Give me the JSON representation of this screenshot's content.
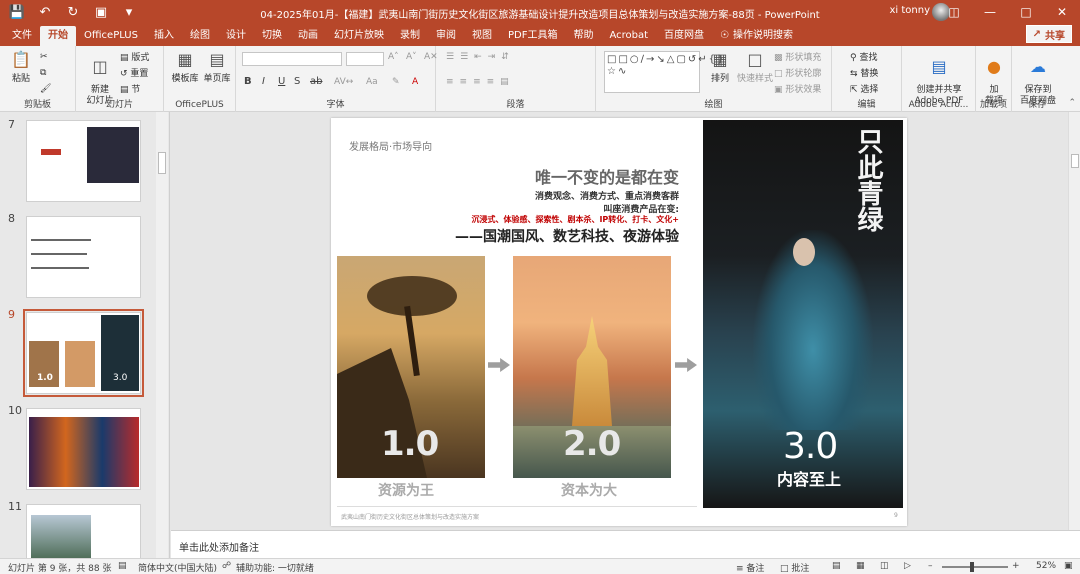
{
  "titlebar": {
    "doc_title": "04-2025年01月-【福建】武夷山南门街历史文化街区旅游基础设计提升改造项目总体策划与改造实施方案-88页 - PowerPoint",
    "user": "xi tonny",
    "icons": [
      "save-icon",
      "undo-icon",
      "redo-icon",
      "present-icon",
      "customize-icon"
    ]
  },
  "menu_tabs": [
    "文件",
    "开始",
    "OfficePLUS",
    "插入",
    "绘图",
    "设计",
    "切换",
    "动画",
    "幻灯片放映",
    "录制",
    "审阅",
    "视图",
    "PDF工具箱",
    "帮助",
    "Acrobat",
    "百度网盘"
  ],
  "active_tab": "开始",
  "tell_me": "操作说明搜索",
  "share": "共享",
  "ribbon": {
    "clipboard": {
      "paste": "粘贴",
      "group": "剪贴板"
    },
    "slides": {
      "new_slide": "新建\n幻灯片",
      "layout": "版式",
      "reset": "重置",
      "section": "节",
      "group": "幻灯片"
    },
    "officeplus": {
      "template": "模板库",
      "single_page": "单页库",
      "group": "OfficePLUS"
    },
    "font": {
      "bold": "B",
      "italic": "I",
      "underline": "U",
      "strike": "S",
      "shadow": "ab",
      "group": "字体"
    },
    "paragraph": {
      "group": "段落"
    },
    "drawing": {
      "arrange": "排列",
      "quick_styles": "快速样式",
      "shape_fill": "形状填充",
      "shape_outline": "形状轮廓",
      "shape_effects": "形状效果",
      "group": "绘图"
    },
    "editing": {
      "find": "查找",
      "replace": "替换",
      "select": "选择",
      "group": "编辑"
    },
    "adobe": {
      "create": "创建并共享\nAdobe PDF",
      "group": "Adobe Acro..."
    },
    "addins": {
      "addins": "加\n载项",
      "group": "加载项"
    },
    "save": {
      "save_baidu": "保存到\n百度网盘",
      "group": "保存"
    }
  },
  "thumbnails": [
    {
      "number": "7"
    },
    {
      "number": "8"
    },
    {
      "number": "9",
      "active": true,
      "num1": "1.0",
      "num3": "3.0"
    },
    {
      "number": "10"
    },
    {
      "number": "11"
    }
  ],
  "slide": {
    "kicker": "发展格局·市场导向",
    "headline": "唯一不变的是都在变",
    "subline1": "消费观念、消费方式、重点消费客群",
    "subline2": "叫座消费产品在变:",
    "red_line": "沉浸式、体验感、探索性、剧本杀、IP转化、打卡、文化+",
    "big_line": "——国潮国风、数艺科技、夜游体验",
    "stage1_number": "1.0",
    "stage1_caption": "资源为王",
    "stage2_number": "2.0",
    "stage2_caption": "资本为大",
    "stage3_number": "3.0",
    "stage3_caption": "内容至上",
    "calligraphy": "只此青绿",
    "footer": "武夷山南门街历史文化街区总体策划与改造实施方案",
    "page": "9"
  },
  "notes_placeholder": "单击此处添加备注",
  "status": {
    "slide_info": "幻灯片 第 9 张，共 88 张",
    "language": "简体中文(中国大陆)",
    "accessibility": "辅助功能: 一切就绪",
    "notes": "备注",
    "comments": "批注",
    "zoom": "52%"
  }
}
